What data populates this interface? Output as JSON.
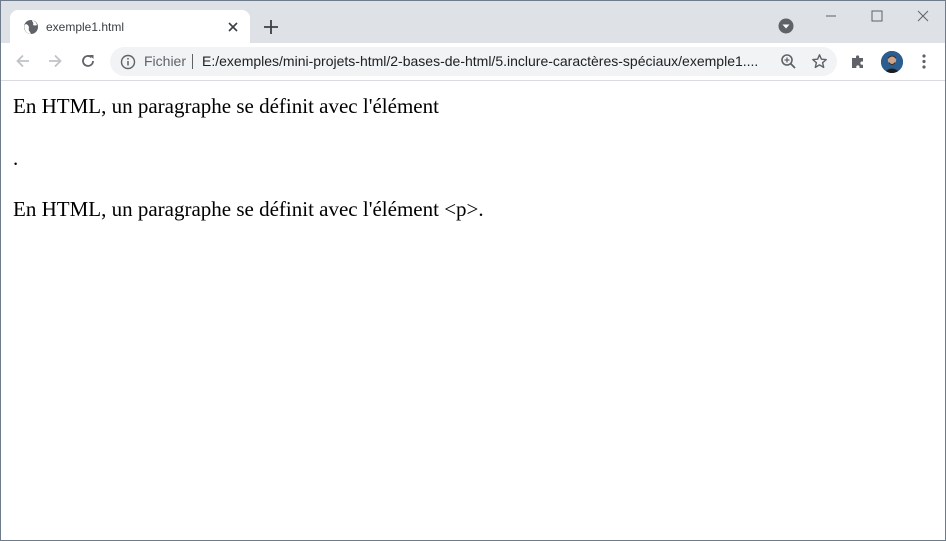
{
  "browser": {
    "tab": {
      "title": "exemple1.html",
      "favicon": "globe-icon"
    },
    "new_tab_icon": "plus-icon",
    "tab_search_icon": "chevron-down-icon",
    "window_controls": [
      "minimize-icon",
      "maximize-icon",
      "close-icon"
    ]
  },
  "toolbar": {
    "back_icon": "arrow-left-icon",
    "forward_icon": "arrow-right-icon",
    "reload_icon": "reload-icon",
    "omnibox": {
      "security_icon": "info-icon",
      "scheme_label": "Fichier",
      "url": "E:/exemples/mini-projets-html/2-bases-de-html/5.inclure-caractères-spéciaux/exemple1...."
    },
    "zoom_icon": "zoom-icon",
    "bookmark_icon": "star-icon",
    "extensions_icon": "puzzle-icon",
    "menu_icon": "more-vert-icon"
  },
  "page": {
    "paragraphs": [
      "En HTML, un paragraphe se définit avec l'élément",
      ".",
      "En HTML, un paragraphe se définit avec l'élément <p>."
    ]
  },
  "colors": {
    "tabstrip_bg": "#dee1e6",
    "omnibox_bg": "#f1f3f4",
    "icon": "#5f6368"
  }
}
